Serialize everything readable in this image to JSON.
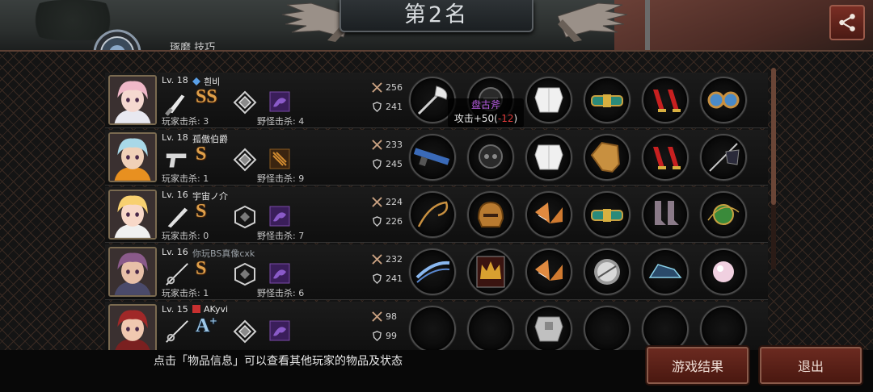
{
  "header": {
    "title": "第2名",
    "emblem_label": "琢磨 技巧",
    "share_icon": "share-icon"
  },
  "tooltip": {
    "item_name": "盘古斧",
    "stat_text": "攻击+50(",
    "stat_delta": "-12",
    "stat_close": ")"
  },
  "players": [
    {
      "level": "Lv. 18",
      "name": "흰비",
      "guild_icon": "blue-gem-icon",
      "weapon_icon": "knife-icon",
      "grade": "SS",
      "grade_plus": "",
      "player_kills": "玩家击杀: 3",
      "monster_kills": "野怪击杀: 4",
      "attack": "256",
      "defense": "241",
      "portrait": {
        "hair": "#f0b8c8",
        "skin": "#f5d8d0",
        "cloth": "#e8e8f0"
      },
      "items": [
        "axe-icon",
        "helmet-icon",
        "armor-icon",
        "belt-icon",
        "red-heels-icon",
        "goggles-icon"
      ]
    },
    {
      "level": "Lv. 18",
      "name": "孤傲伯爵",
      "guild_icon": "",
      "weapon_icon": "pistol-icon",
      "grade": "S",
      "grade_plus": "",
      "player_kills": "玩家击杀: 1",
      "monster_kills": "野怪击杀: 9",
      "attack": "233",
      "defense": "245",
      "portrait": {
        "hair": "#a8d8e8",
        "skin": "#f0d0b8",
        "cloth": "#e89020"
      },
      "items": [
        "rifle-icon",
        "skull-helmet-icon",
        "armor-icon",
        "shield-icon",
        "red-heels-icon",
        "flag-icon"
      ]
    },
    {
      "level": "Lv. 16",
      "name": "宇宙ノ介",
      "guild_icon": "",
      "weapon_icon": "bat-icon",
      "grade": "S",
      "grade_plus": "",
      "player_kills": "玩家击杀: 0",
      "monster_kills": "野怪击杀: 7",
      "attack": "224",
      "defense": "226",
      "portrait": {
        "hair": "#f8d070",
        "skin": "#f8d8c8",
        "cloth": "#f0f0f0"
      },
      "items": [
        "whip-icon",
        "gold-helmet-icon",
        "scale-armor-icon",
        "belt-icon",
        "boots-icon",
        "green-orb-icon"
      ]
    },
    {
      "level": "Lv. 16",
      "name": "你玩BS真像cxk",
      "guild_icon": "",
      "weapon_icon": "rapier-icon",
      "grade": "S",
      "grade_plus": "",
      "player_kills": "玩家击杀: 1",
      "monster_kills": "野怪击杀: 6",
      "attack": "232",
      "defense": "241",
      "portrait": {
        "hair": "#8a5a8a",
        "skin": "#e8c0a8",
        "cloth": "#4a4a6a"
      },
      "items": [
        "blade-icon",
        "crown-icon",
        "scale-armor-icon",
        "disc-icon",
        "sneaker-icon",
        "pearl-icon"
      ]
    },
    {
      "level": "Lv. 15",
      "name": "AKyvi",
      "guild_icon": "red-flag-icon",
      "weapon_icon": "rapier-icon",
      "grade": "A",
      "grade_plus": "+",
      "player_kills": "",
      "monster_kills": "",
      "attack": "98",
      "defense": "99",
      "portrait": {
        "hair": "#a02828",
        "skin": "#f0c8b0",
        "cloth": "#7a2020"
      },
      "items": [
        "empty-slot",
        "empty-slot",
        "plate-armor-icon",
        "empty-slot",
        "empty-slot",
        "empty-slot"
      ]
    }
  ],
  "footer": {
    "hint": "点击「物品信息」可以查看其他玩家的物品及状态",
    "result_button": "游戏结果",
    "exit_button": "退出"
  },
  "colors": {
    "accent_red": "#6b2a20",
    "grade_gold": "#e0a04a",
    "grade_blue": "#9ec8e8",
    "tooltip_name": "#b65de0",
    "tooltip_delta": "#e03a3a"
  }
}
